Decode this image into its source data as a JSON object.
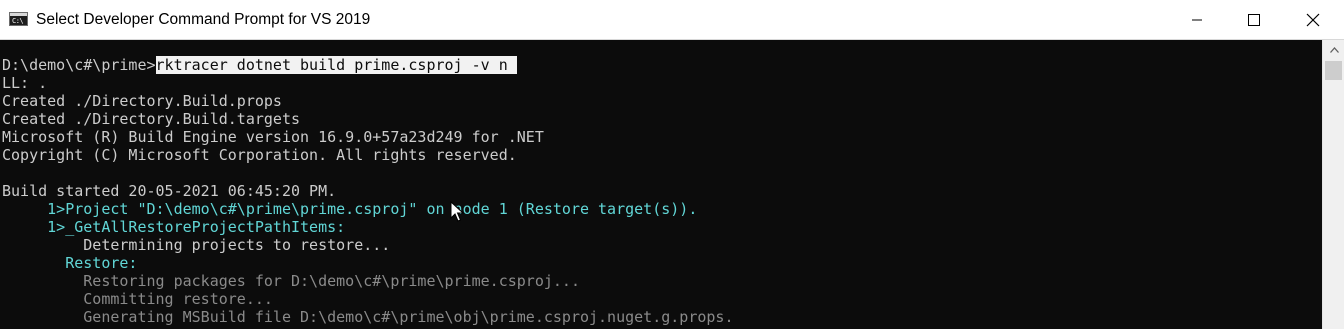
{
  "window": {
    "title": "Select Developer Command Prompt for VS 2019",
    "app_icon_text": "C:\\"
  },
  "controls": {
    "minimize": "minimize-icon",
    "maximize": "maximize-icon",
    "close": "close-icon"
  },
  "console": {
    "prompt": "D:\\demo\\c#\\prime>",
    "command": "rktracer dotnet build prime.csproj -v n ",
    "lines": [
      "LL: .",
      "Created ./Directory.Build.props",
      "Created ./Directory.Build.targets",
      "Microsoft (R) Build Engine version 16.9.0+57a23d249 for .NET",
      "Copyright (C) Microsoft Corporation. All rights reserved.",
      "",
      "Build started 20-05-2021 06:45:20 PM.",
      "     1>Project \"D:\\demo\\c#\\prime\\prime.csproj\" on node 1 (Restore target(s)).",
      "     1>_GetAllRestoreProjectPathItems:",
      "         Determining projects to restore...",
      "       Restore:",
      "         Restoring packages for D:\\demo\\c#\\prime\\prime.csproj...",
      "         Committing restore...",
      "         Generating MSBuild file D:\\demo\\c#\\prime\\obj\\prime.csproj.nuget.g.props."
    ]
  },
  "colors": {
    "console_bg": "#0c0c0c",
    "text": "#cccccc",
    "cyan": "#3a96dd",
    "teal": "#61d6d6",
    "dim": "#8a8a8a"
  }
}
